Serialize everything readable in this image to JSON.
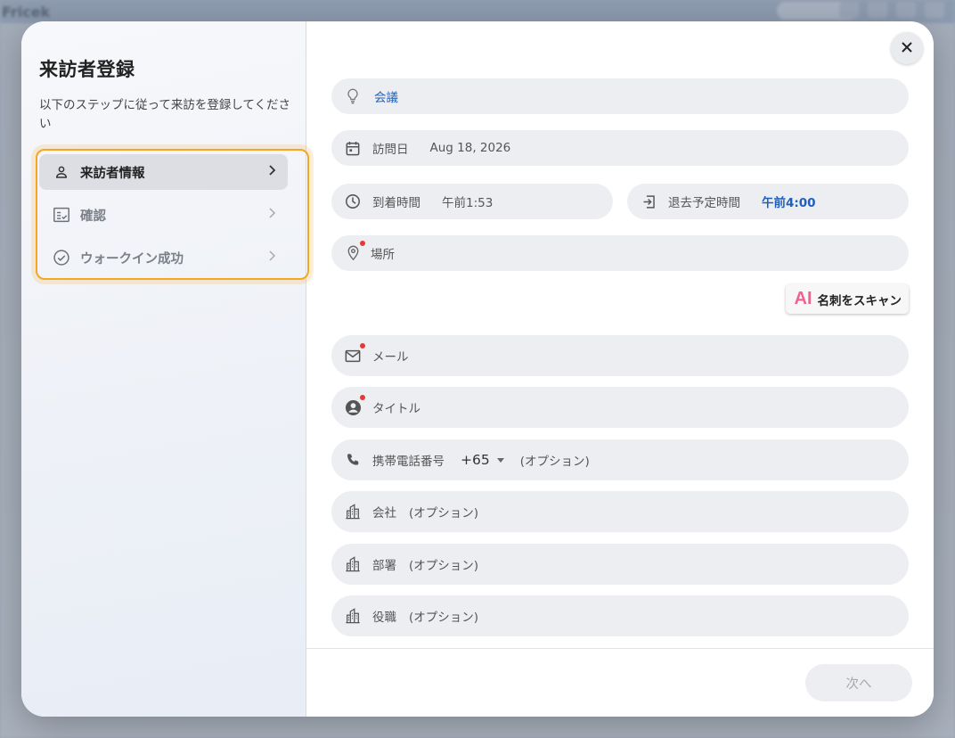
{
  "background": {
    "app_title": "Fricek"
  },
  "sidebar": {
    "title": "来訪者登録",
    "subtitle": "以下のステップに従って来訪を登録してください",
    "steps": [
      {
        "label": "来訪者情報",
        "icon": "person-icon",
        "active": true
      },
      {
        "label": "確認",
        "icon": "checklist-icon",
        "active": false
      },
      {
        "label": "ウォークイン成功",
        "icon": "check-circle-icon",
        "active": false
      }
    ]
  },
  "form": {
    "purpose": {
      "value": "会議",
      "icon": "lightbulb-icon"
    },
    "visit_date": {
      "label": "訪問日",
      "value": "Aug 18, 2026",
      "icon": "calendar-icon"
    },
    "arrival_time": {
      "label": "到着時間",
      "value": "午前1:53",
      "icon": "clock-icon"
    },
    "departure_time": {
      "label": "退去予定時間",
      "value": "午前4:00",
      "icon": "exit-icon"
    },
    "location": {
      "placeholder": "場所",
      "icon": "location-pin-icon",
      "required": true
    },
    "scan_button": {
      "ai": "AI",
      "label": "名刺をスキャン"
    },
    "email": {
      "placeholder": "メール",
      "icon": "mail-icon",
      "required": true
    },
    "title": {
      "placeholder": "タイトル",
      "icon": "account-circle-icon",
      "required": true
    },
    "mobile": {
      "label": "携帯電話番号",
      "country_code": "+65",
      "placeholder": "(オプション)",
      "icon": "phone-icon"
    },
    "company": {
      "label": "会社",
      "placeholder": "(オプション)",
      "icon": "building-icon"
    },
    "department": {
      "label": "部署",
      "placeholder": "(オプション)",
      "icon": "building-icon"
    },
    "position": {
      "label": "役職",
      "placeholder": "(オプション)",
      "icon": "building-icon"
    }
  },
  "footer": {
    "next_label": "次へ"
  },
  "colors": {
    "accent": "#1f5fbf",
    "highlight": "#f5a623",
    "required": "#e53935",
    "ai": "#f06292"
  }
}
